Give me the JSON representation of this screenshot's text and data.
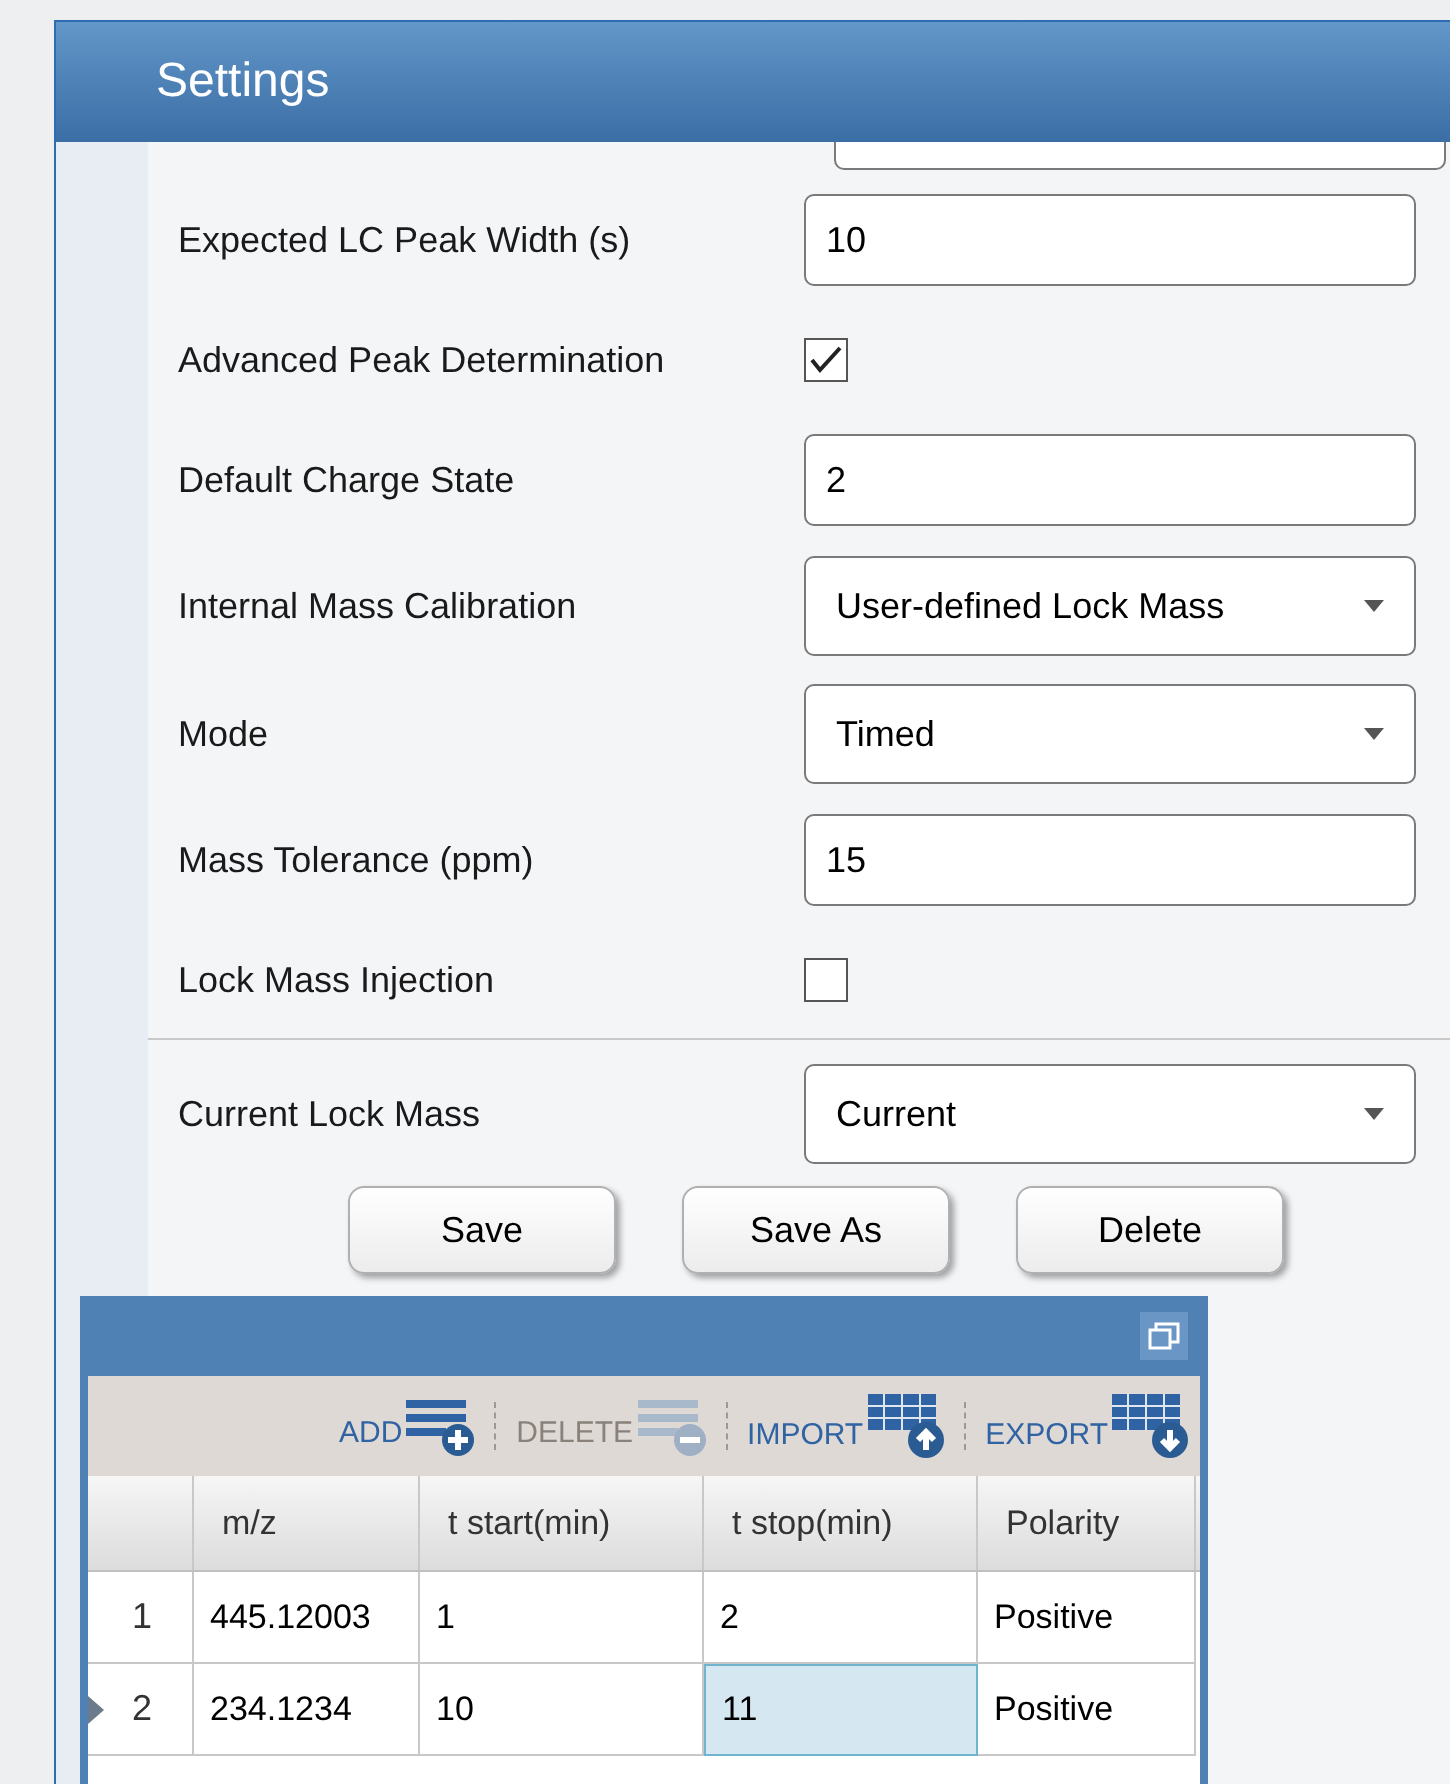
{
  "window": {
    "title": "Settings"
  },
  "fields": [
    {
      "kind": "text",
      "label": "Expected LC Peak Width (s)",
      "value": "10"
    },
    {
      "kind": "checkbox",
      "label": "Advanced Peak Determination",
      "checked": true
    },
    {
      "kind": "text",
      "label": "Default Charge State",
      "value": "2"
    },
    {
      "kind": "select",
      "label": "Internal Mass Calibration",
      "value": "User-defined Lock Mass"
    },
    {
      "kind": "select",
      "label": "Mode",
      "value": "Timed"
    },
    {
      "kind": "text",
      "label": "Mass Tolerance (ppm)",
      "value": "15"
    },
    {
      "kind": "checkbox",
      "label": "Lock Mass Injection",
      "checked": false
    },
    {
      "kind": "separator"
    },
    {
      "kind": "select",
      "label": "Current Lock Mass",
      "value": "Current"
    }
  ],
  "buttons": [
    "Save",
    "Save As",
    "Delete"
  ],
  "grid": {
    "toolbar": [
      {
        "kind": "add",
        "label": "ADD",
        "disabled": false
      },
      {
        "kind": "delete",
        "label": "DELETE",
        "disabled": true
      },
      {
        "kind": "import",
        "label": "IMPORT",
        "disabled": false
      },
      {
        "kind": "export",
        "label": "EXPORT",
        "disabled": false
      }
    ],
    "columns": [
      "m/z",
      "t start(min)",
      "t stop(min)",
      "Polarity"
    ],
    "rows": [
      {
        "number": "1",
        "current": false,
        "cells": [
          {
            "text": "445.12003",
            "selected": false
          },
          {
            "text": "1",
            "selected": false
          },
          {
            "text": "2",
            "selected": false
          },
          {
            "text": "Positive",
            "selected": false
          }
        ]
      },
      {
        "number": "2",
        "current": true,
        "cells": [
          {
            "text": "234.1234",
            "selected": false
          },
          {
            "text": "10",
            "selected": false
          },
          {
            "text": "11",
            "selected": true
          },
          {
            "text": "Positive",
            "selected": false
          }
        ]
      }
    ]
  }
}
